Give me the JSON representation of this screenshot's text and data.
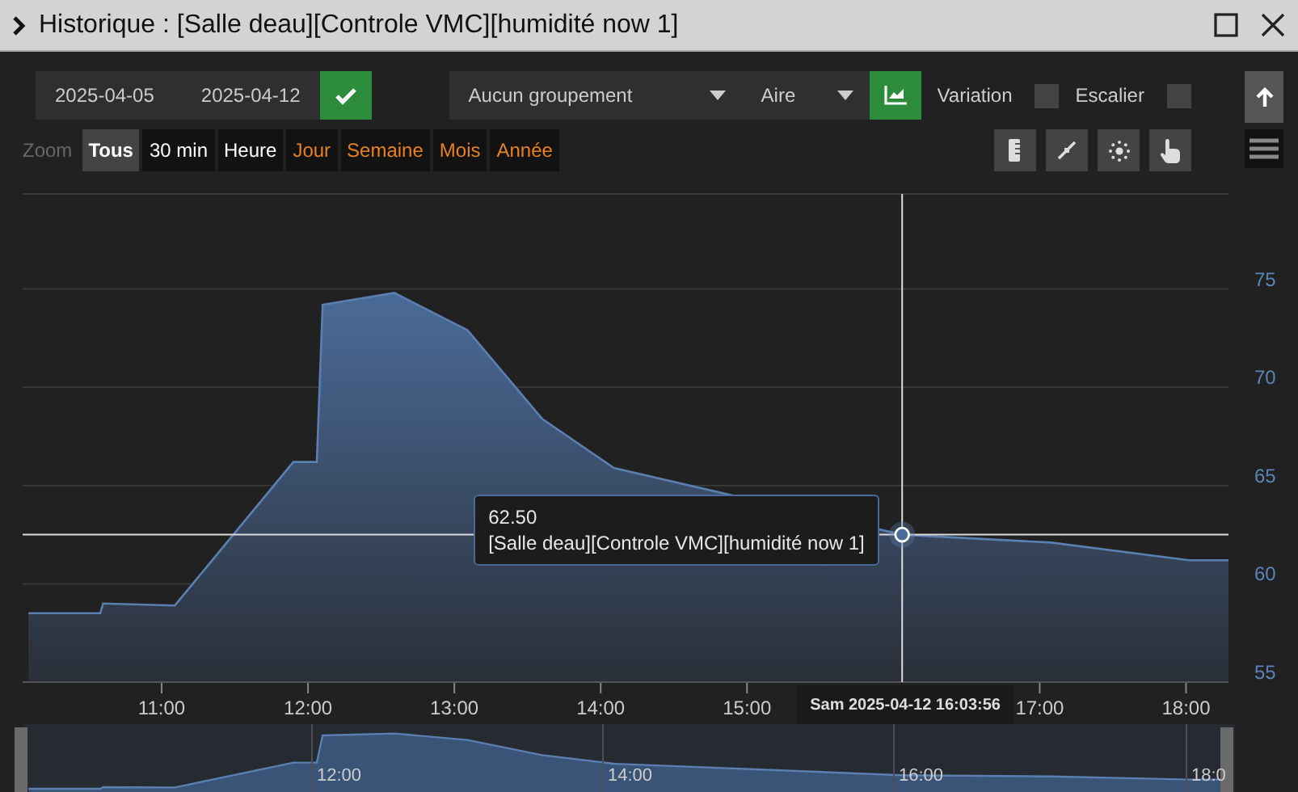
{
  "window": {
    "title": "Historique : [Salle deau][Controle VMC][humidité now 1]"
  },
  "toolbar": {
    "start_date": "2025-04-05",
    "end_date": "2025-04-12",
    "grouping": "Aucun groupement",
    "chart_type": "Aire",
    "options": [
      {
        "label": "Variation",
        "checked": false
      },
      {
        "label": "Escalier",
        "checked": false
      }
    ]
  },
  "zoom": {
    "label": "Zoom",
    "buttons": [
      {
        "label": "Tous",
        "selected": true,
        "color": "#ffffff"
      },
      {
        "label": "30 min",
        "selected": false,
        "color": "#ffffff"
      },
      {
        "label": "Heure",
        "selected": false,
        "color": "#ffffff"
      },
      {
        "label": "Jour",
        "selected": false,
        "color": "#e8801e"
      },
      {
        "label": "Semaine",
        "selected": false,
        "color": "#e8801e"
      },
      {
        "label": "Mois",
        "selected": false,
        "color": "#e8801e"
      },
      {
        "label": "Année",
        "selected": false,
        "color": "#e8801e"
      }
    ]
  },
  "chart_data": {
    "type": "area",
    "grid": true,
    "xlim": [
      10.05,
      18.29
    ],
    "ylim": [
      55,
      80
    ],
    "x": [
      10.09,
      10.58,
      10.6,
      11.09,
      11.9,
      12.06,
      12.1,
      12.59,
      13.09,
      13.6,
      14.09,
      15.09,
      16.06,
      17.08,
      18.02,
      18.29
    ],
    "series": [
      {
        "name": "[Salle deau][Controle VMC][humidité now 1]",
        "color": "#5a7fb0",
        "values": [
          58.5,
          58.5,
          59.0,
          58.9,
          66.2,
          66.2,
          74.2,
          74.8,
          72.9,
          68.4,
          65.9,
          null,
          62.5,
          62.1,
          61.2,
          61.2
        ]
      }
    ],
    "xticks": [
      {
        "value": 11,
        "label": "11:00"
      },
      {
        "value": 12,
        "label": "12:00"
      },
      {
        "value": 13,
        "label": "13:00"
      },
      {
        "value": 14,
        "label": "14:00"
      },
      {
        "value": 15,
        "label": "15:00"
      },
      {
        "value": 17,
        "label": "17:00"
      },
      {
        "value": 18,
        "label": "18:00"
      }
    ],
    "yticks": [
      55,
      60,
      65,
      70,
      75
    ],
    "ref_lines": [
      {
        "axis": "y",
        "value": 62.5
      },
      {
        "axis": "x",
        "value": 16.06
      }
    ]
  },
  "crosshair": {
    "time_label": "Sam 2025-04-12 16:03:56"
  },
  "tooltip": {
    "value": "62.50"
  },
  "navigator": {
    "labels": [
      "12:00",
      "14:00",
      "16:00",
      "18:0"
    ]
  }
}
